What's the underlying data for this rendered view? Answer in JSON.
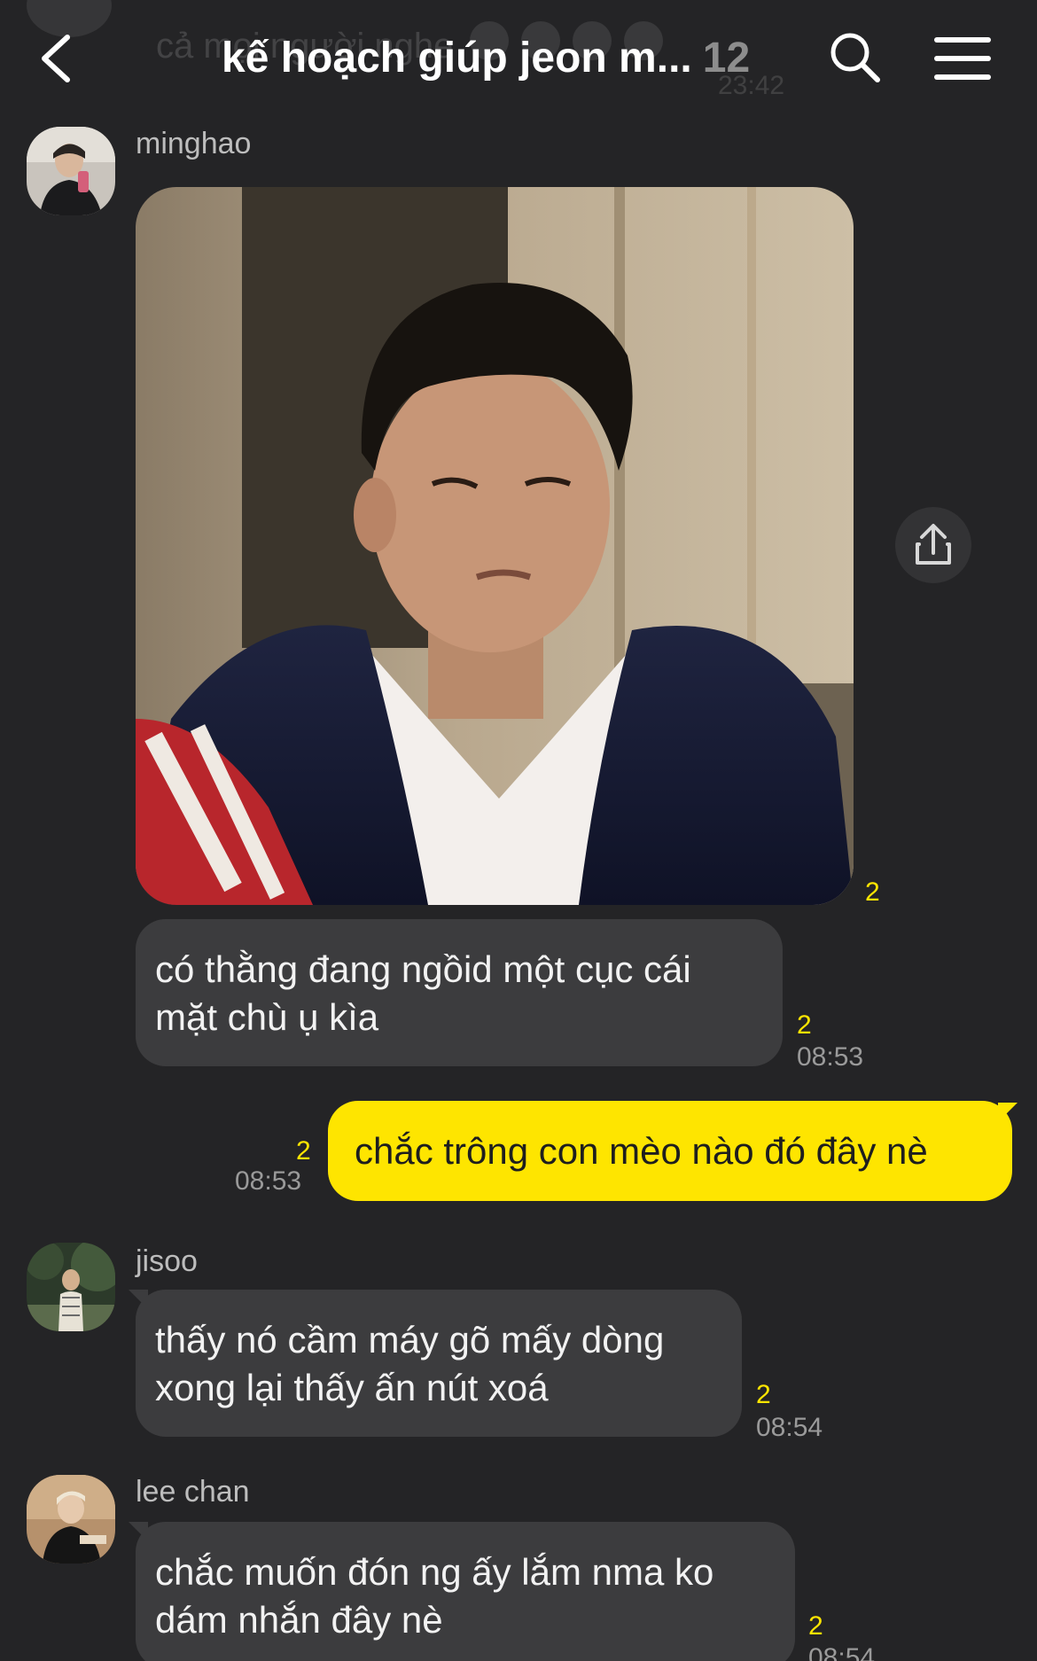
{
  "header": {
    "title": "kế hoạch giúp jeon m...",
    "member_count": "12",
    "ghost_text": "cả mọi người nghe",
    "ghost_time": "23:42"
  },
  "messages": [
    {
      "sender": "minghao",
      "type": "image",
      "unread": "2"
    },
    {
      "sender": "",
      "type": "text",
      "text_lines": [
        "có thằng đang ngồid một cục cái",
        "mặt chù ụ kìa"
      ],
      "unread": "2",
      "time": "08:53"
    },
    {
      "sender": "me",
      "type": "text",
      "text_lines": [
        "chắc trông con mèo nào đó đây nè"
      ],
      "unread": "2",
      "time": "08:53"
    },
    {
      "sender": "jisoo",
      "type": "text",
      "text_lines": [
        "thấy nó cầm máy gõ mấy dòng",
        "xong lại thấy ấn nút xoá"
      ],
      "unread": "2",
      "time": "08:54"
    },
    {
      "sender": "lee chan",
      "type": "text",
      "text_lines": [
        "chắc muốn đón ng ấy lắm nma ko",
        "dám nhắn đây nè"
      ],
      "unread": "2",
      "time": "08:54"
    }
  ],
  "icons": {
    "back": "chevron-left-icon",
    "search": "search-icon",
    "menu": "hamburger-menu-icon",
    "share": "share-icon"
  },
  "colors": {
    "background": "#242426",
    "incoming_bubble": "#3c3c3e",
    "outgoing_bubble": "#fee500",
    "unread_count": "#fee500"
  }
}
